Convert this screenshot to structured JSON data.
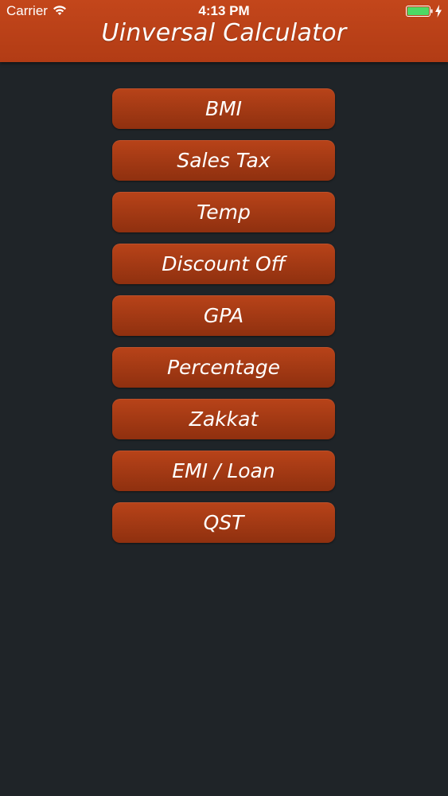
{
  "status_bar": {
    "carrier": "Carrier",
    "time": "4:13 PM",
    "wifi_icon": "wifi-icon",
    "battery_icon": "battery-icon",
    "charging_icon": "charging-bolt-icon",
    "battery_color": "#4cd964"
  },
  "header": {
    "title": "Uinversal Calculator",
    "bar_color": "#bd4219"
  },
  "menu": {
    "button_color": "#a63a14",
    "items": [
      {
        "label": "BMI"
      },
      {
        "label": "Sales Tax"
      },
      {
        "label": "Temp"
      },
      {
        "label": "Discount Off"
      },
      {
        "label": "GPA"
      },
      {
        "label": "Percentage"
      },
      {
        "label": "Zakkat"
      },
      {
        "label": "EMI / Loan"
      },
      {
        "label": "QST"
      }
    ]
  },
  "background_color": "#1f2428"
}
